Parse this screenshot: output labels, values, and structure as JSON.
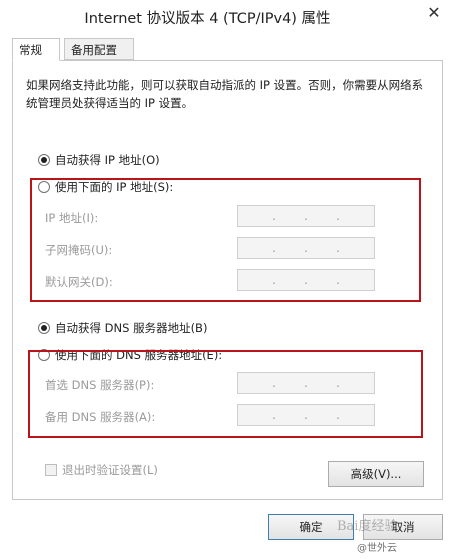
{
  "window": {
    "title": "Internet 协议版本 4 (TCP/IPv4) 属性",
    "close_glyph": "✕"
  },
  "tabs": [
    {
      "label": "常规",
      "active": true
    },
    {
      "label": "备用配置",
      "active": false
    }
  ],
  "description": "如果网络支持此功能，则可以获取自动指派的 IP 设置。否则，你需要从网络系统管理员处获得适当的 IP 设置。",
  "ip_section": {
    "auto_label": "自动获得 IP 地址(O)",
    "manual_label": "使用下面的 IP 地址(S):",
    "selected": "auto",
    "fields": [
      {
        "label": "IP 地址(I):",
        "value": ". . ."
      },
      {
        "label": "子网掩码(U):",
        "value": ". . ."
      },
      {
        "label": "默认网关(D):",
        "value": ". . ."
      }
    ]
  },
  "dns_section": {
    "auto_label": "自动获得 DNS 服务器地址(B)",
    "manual_label": "使用下面的 DNS 服务器地址(E):",
    "selected": "auto",
    "fields": [
      {
        "label": "首选 DNS 服务器(P):",
        "value": ". . ."
      },
      {
        "label": "备用 DNS 服务器(A):",
        "value": ". . ."
      }
    ]
  },
  "validate_on_exit": {
    "label": "退出时验证设置(L)",
    "checked": false,
    "enabled": false
  },
  "buttons": {
    "advanced": "高级(V)...",
    "ok": "确定",
    "cancel": "取消"
  },
  "watermark": {
    "main": "Bai度经验",
    "sub": "@世外云"
  },
  "colors": {
    "highlight_box": "#b8141a",
    "disabled_text": "#9a9a9a"
  }
}
